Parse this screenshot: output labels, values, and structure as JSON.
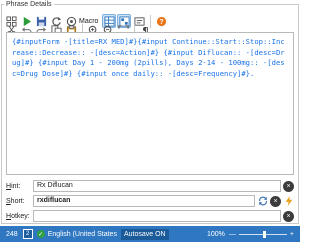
{
  "panel": {
    "title": "Phrase Details"
  },
  "toolbar": {
    "macro_label": "Macro",
    "icons": [
      "grid-icon",
      "play-icon",
      "save-icon",
      "refresh-icon",
      "macro-icon",
      "table-icon",
      "layout-icon",
      "form-icon",
      "help-icon",
      "cut-icon",
      "undo-icon",
      "redo-icon",
      "copy-icon",
      "paste-icon",
      "zoom-in-icon",
      "zoom-out-icon",
      "expand-icon",
      "paragraph-icon"
    ]
  },
  "editor": {
    "content": "{#inputForm -[title=RX MED]#}{#input Continue::Start::Stop::Increase::Decrease:: -[desc=Action]#} {#input Diflucan:: -[desc=Drug]#} {#input Day 1 - 200mg (2pills), Days 2-14 - 100mg:: -[desc=Drug Dose]#} {#input once daily:: -[desc=Frequency]#}."
  },
  "fields": {
    "hint": {
      "label_key": "H",
      "label_rest": "int:",
      "value": "Rx Diflucan"
    },
    "short": {
      "label_key": "S",
      "label_rest": "hort:",
      "value": "rxdiflucan"
    },
    "hotkey": {
      "label_key": "H",
      "label_rest": "otkey:",
      "value": ""
    }
  },
  "status": {
    "count": "248",
    "box_label": "2",
    "language": "English (United States",
    "autosave": "Autosave ON",
    "zoom": "100%",
    "zoom_minus": "—",
    "zoom_plus": "+",
    "zoom_level": 0.5
  },
  "colors": {
    "accent": "#2f77c0",
    "code_text": "#1a73e8"
  }
}
